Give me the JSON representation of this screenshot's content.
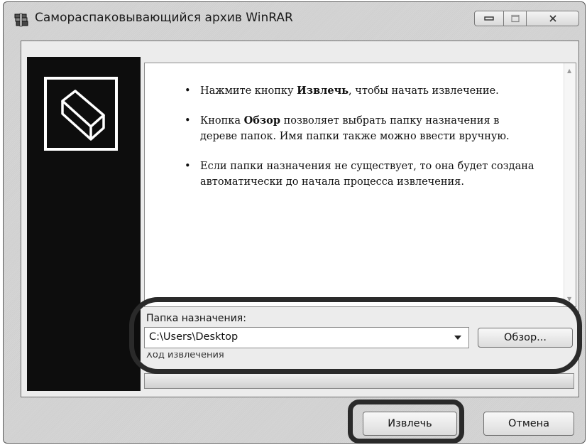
{
  "window": {
    "title": "Самораспаковывающийся архив WinRAR",
    "icons": {
      "app": "winrar-archive-icon",
      "minimize": "minimize-icon",
      "maximize": "maximize-icon",
      "close": "close-icon"
    }
  },
  "sidebar": {
    "logo_icon": "archive-box-icon"
  },
  "instructions": [
    {
      "before": "Нажмите кнопку ",
      "bold": "Извлечь",
      "after": ", чтобы начать извлечение."
    },
    {
      "before": "Кнопка ",
      "bold": "Обзор",
      "after": " позволяет выбрать папку назначения в дереве папок. Имя папки также можно ввести вручную."
    },
    {
      "before": "",
      "bold": "",
      "after": "Если папки назначения не существует, то она будет создана автоматически до начала процесса извлечения."
    }
  ],
  "destination": {
    "label": "Папка назначения:",
    "value": "C:\\Users\\Desktop",
    "browse_label": "Обзор..."
  },
  "progress": {
    "label": "Ход извлечения",
    "value": 0
  },
  "buttons": {
    "extract": "Извлечь",
    "cancel": "Отмена"
  }
}
